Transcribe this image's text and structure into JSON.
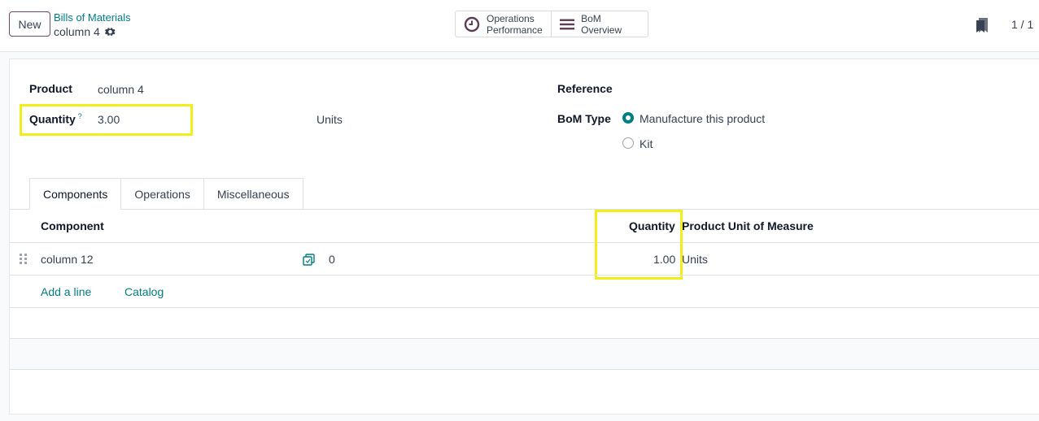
{
  "control_panel": {
    "new_label": "New",
    "breadcrumb": "Bills of Materials",
    "record_name": "column 4",
    "smart_buttons": [
      {
        "line1": "Operations",
        "line2": "Performance",
        "icon": "clock-icon"
      },
      {
        "label": "BoM Overview",
        "icon": "bars-icon"
      }
    ],
    "pager": "1 / 1"
  },
  "form": {
    "product_label": "Product",
    "product_value": "column 4",
    "quantity_label": "Quantity",
    "quantity_help": "?",
    "quantity_value": "3.00",
    "uom_value": "Units",
    "reference_label": "Reference",
    "bom_type_label": "BoM Type",
    "bom_type_options": [
      {
        "label": "Manufacture this product",
        "selected": true
      },
      {
        "label": "Kit",
        "selected": false
      }
    ]
  },
  "tabs": [
    "Components",
    "Operations",
    "Miscellaneous"
  ],
  "components_table": {
    "headers": {
      "component": "Component",
      "quantity": "Quantity",
      "uom": "Product Unit of Measure"
    },
    "rows": [
      {
        "component": "column 12",
        "count": "0",
        "quantity": "1.00",
        "uom": "Units"
      }
    ],
    "add_line": "Add a line",
    "catalog": "Catalog"
  },
  "colors": {
    "accent": "#017e84",
    "brand": "#714b67",
    "highlight": "#f2ee1a"
  }
}
